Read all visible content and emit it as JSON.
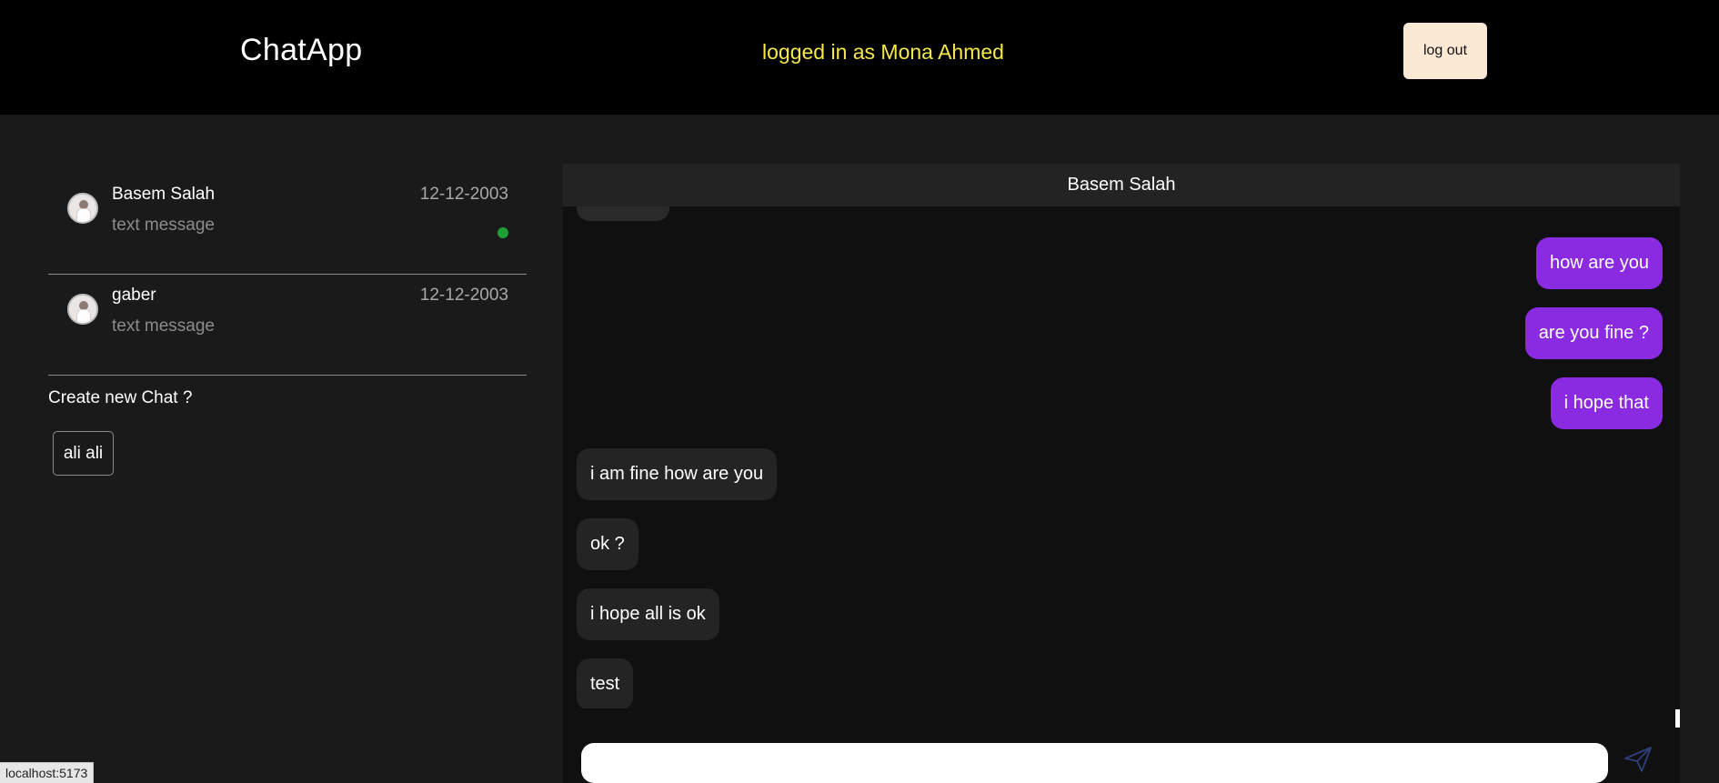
{
  "header": {
    "brand": "ChatApp",
    "logged_in_text": "logged in as Mona Ahmed",
    "logout_label": "log out"
  },
  "sidebar": {
    "chats": [
      {
        "name": "Basem Salah",
        "date": "12-12-2003",
        "preview": "text message",
        "online": true
      },
      {
        "name": "gaber",
        "date": "12-12-2003",
        "preview": "text message",
        "online": false
      }
    ],
    "create_label": "Create new Chat ?",
    "users": [
      "ali ali"
    ]
  },
  "conversation": {
    "title": "Basem Salah",
    "messages": [
      {
        "text": "how are you",
        "direction": "out"
      },
      {
        "text": "are you fine ?",
        "direction": "out"
      },
      {
        "text": "i hope that",
        "direction": "out"
      },
      {
        "text": "i am fine how are you",
        "direction": "in"
      },
      {
        "text": "ok ?",
        "direction": "in"
      },
      {
        "text": "i hope all is ok",
        "direction": "in"
      },
      {
        "text": "test",
        "direction": "in"
      }
    ],
    "composer_value": "",
    "send_icon": "send-icon"
  },
  "status_bar": {
    "url": "localhost:5173"
  },
  "colors": {
    "accent_out": "#8a2be2",
    "logged_in": "#f5e84a",
    "online": "#1f9e36",
    "logout_bg": "#fbe9d6"
  }
}
